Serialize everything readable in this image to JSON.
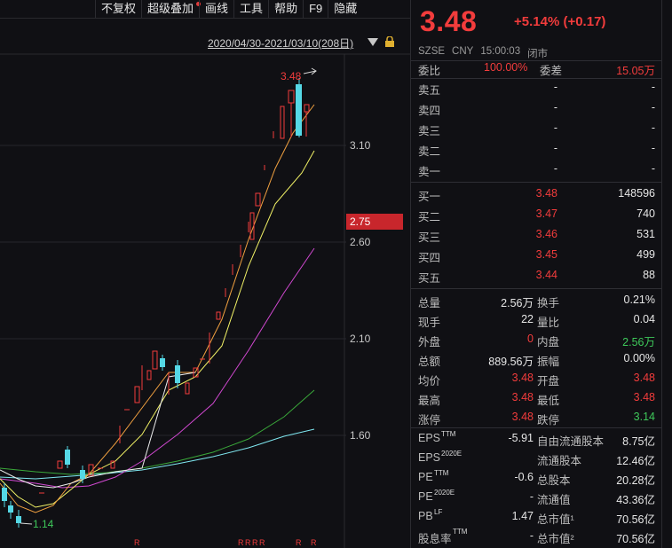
{
  "toolbar": {
    "items": [
      "不复权",
      "超级叠加",
      "画线",
      "工具",
      "帮助",
      "F9",
      "隐藏"
    ]
  },
  "chart": {
    "date_range": "2020/04/30-2021/03/10(208日)",
    "price_labels": [
      "3.10",
      "2.60",
      "2.10",
      "1.60"
    ],
    "current_price_tag": "2.75",
    "high_label": "3.48",
    "low_label": "1.14",
    "marker": "R"
  },
  "quote": {
    "price": "3.48",
    "change": "+5.14% (+0.17)",
    "meta": [
      "SZSE",
      "CNY",
      "15:00:03",
      "闭市"
    ],
    "weibi_label": "委比",
    "weibi_value": "100.00%",
    "weicha_label": "委差",
    "weicha_value": "15.05万",
    "sell": [
      {
        "label": "卖五",
        "price": "-",
        "vol": "-"
      },
      {
        "label": "卖四",
        "price": "-",
        "vol": "-"
      },
      {
        "label": "卖三",
        "price": "-",
        "vol": "-"
      },
      {
        "label": "卖二",
        "price": "-",
        "vol": "-"
      },
      {
        "label": "卖一",
        "price": "-",
        "vol": "-"
      }
    ],
    "buy": [
      {
        "label": "买一",
        "price": "3.48",
        "vol": "148596"
      },
      {
        "label": "买二",
        "price": "3.47",
        "vol": "740"
      },
      {
        "label": "买三",
        "price": "3.46",
        "vol": "531"
      },
      {
        "label": "买四",
        "price": "3.45",
        "vol": "499"
      },
      {
        "label": "买五",
        "price": "3.44",
        "vol": "88"
      }
    ],
    "stats": [
      {
        "l1": "总量",
        "v1": "2.56万",
        "c1": "white",
        "l2": "换手",
        "v2": "0.21%",
        "c2": "white"
      },
      {
        "l1": "现手",
        "v1": "22",
        "c1": "white",
        "l2": "量比",
        "v2": "0.04",
        "c2": "white"
      },
      {
        "l1": "外盘",
        "v1": "0",
        "c1": "red",
        "l2": "内盘",
        "v2": "2.56万",
        "c2": "green"
      },
      {
        "l1": "总额",
        "v1": "889.56万",
        "c1": "white",
        "l2": "振幅",
        "v2": "0.00%",
        "c2": "white"
      },
      {
        "l1": "均价",
        "v1": "3.48",
        "c1": "red",
        "l2": "开盘",
        "v2": "3.48",
        "c2": "red"
      },
      {
        "l1": "最高",
        "v1": "3.48",
        "c1": "red",
        "l2": "最低",
        "v2": "3.48",
        "c2": "red"
      },
      {
        "l1": "涨停",
        "v1": "3.48",
        "c1": "red",
        "l2": "跌停",
        "v2": "3.14",
        "c2": "green"
      }
    ],
    "fund": [
      {
        "l1": "EPS",
        "s1": "TTM",
        "v1": "-5.91",
        "l2": "自由流通股本",
        "v2": "8.75亿"
      },
      {
        "l1": "EPS",
        "s1": "2020E",
        "v1": "",
        "l2": "流通股本",
        "v2": "12.46亿"
      },
      {
        "l1": "PE",
        "s1": "TTM",
        "v1": "-0.6",
        "l2": "总股本",
        "v2": "20.28亿"
      },
      {
        "l1": "PE",
        "s1": "2020E",
        "v1": "-",
        "l2": "流通值",
        "v2": "43.36亿"
      },
      {
        "l1": "PB",
        "s1": "LF",
        "v1": "1.47",
        "l2": "总市值¹",
        "v2": "70.56亿"
      },
      {
        "l1": "股息率",
        "s1": "TTM",
        "v1": "-",
        "l2": "总市值²",
        "v2": "70.56亿"
      }
    ]
  },
  "colors": {
    "up": "#f23c3c",
    "down": "#3ec85a",
    "bg": "#101014"
  }
}
